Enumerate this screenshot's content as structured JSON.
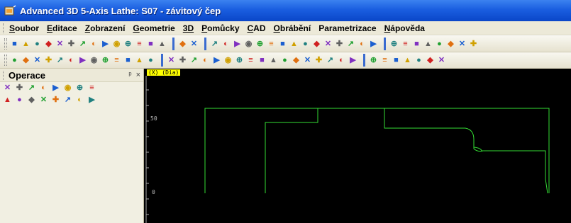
{
  "window": {
    "title": "Advanced 3D 5-Axis Lathe: S07 - závitový čep"
  },
  "menu": [
    {
      "u": "S",
      "rest": "oubor"
    },
    {
      "u": "E",
      "rest": "ditace"
    },
    {
      "u": "Z",
      "rest": "obrazení"
    },
    {
      "u": "G",
      "rest": "eometrie"
    },
    {
      "u": "3D",
      "rest": ""
    },
    {
      "u": "P",
      "rest": "omůcky"
    },
    {
      "u": "C",
      "rest": "AD"
    },
    {
      "u": "O",
      "rest": "brábění"
    },
    {
      "u": "",
      "rest": "Parametrizace"
    },
    {
      "u": "N",
      "rest": "ápověda"
    }
  ],
  "panel": {
    "title": "Operace",
    "pin": "ᵖ",
    "close": "×"
  },
  "canvas": {
    "axis_label": "(X) (Dia)",
    "tick_50": "50",
    "tick_0": "0"
  },
  "colors": {
    "title_bar": "#1a5ee0",
    "canvas_bg": "#000000",
    "geometry": "#33dd33",
    "axis": "#ffff00"
  },
  "toolbar1_icons": [
    "new-file-icon",
    "open-icon",
    "save-icon",
    "check-icon",
    "arc-icon",
    "circle-minus-icon",
    "box-icon",
    "curve-icon",
    "circle-icon",
    "ellipse-icon",
    "spline-icon",
    "target-icon",
    "arc-yellow-icon",
    "arrow-icon",
    "sep",
    "arc-red-icon",
    "sheet-icon",
    "sep",
    "undo-icon",
    "delete-icon",
    "trim-icon",
    "extend-icon",
    "offset-icon",
    "mirror-icon",
    "split-icon",
    "chamfer-icon",
    "line-h-icon",
    "line-h2-icon",
    "line-end-icon",
    "corner-icon",
    "slope-icon",
    "bars-icon",
    "tools-icon",
    "sep",
    "tool-a-icon",
    "tool-b-icon",
    "tool-c-icon",
    "tool-d-icon",
    "tool-e-icon",
    "tool-f-icon",
    "tool-g-icon",
    "tool-h-icon"
  ],
  "toolbar2_icons": [
    "zoom-icon",
    "zoom-in-icon",
    "zoom-out-icon",
    "zoom-window-icon",
    "pan-icon",
    "view-icon",
    "step-icon",
    "shade-icon",
    "3d-icon",
    "rotate-icon",
    "orbit-icon",
    "solid-icon",
    "layers-icon",
    "sep",
    "point-icon",
    "node-icon",
    "snap-icon",
    "grid-icon",
    "lathe-a-icon",
    "lathe-b-icon",
    "lathe-c-icon",
    "lathe-d-icon",
    "lathe-e-icon",
    "lathe-f-icon",
    "lathe-g-icon",
    "lathe-h-icon",
    "lathe-i-icon",
    "lathe-j-icon",
    "lathe-k-icon",
    "lathe-l-icon",
    "lathe-m-icon",
    "sep",
    "mark-a-icon",
    "mark-b-icon",
    "mark-c-icon",
    "mark-d-icon",
    "mark-e-icon",
    "mark-f-icon",
    "mark-g-icon"
  ],
  "panel_icons_row1": [
    "tree-icon",
    "list-icon",
    "number-icon",
    "tool-icon",
    "up-arrow-icon",
    "down-arrow-icon",
    "cross-icon",
    "report-icon"
  ],
  "panel_icons_row2": [
    "delete-op-icon",
    "undo-op-icon",
    "lock-icon",
    "stop-icon",
    "star-icon",
    "dot-icon",
    "diamond-icon",
    "insert-icon"
  ]
}
